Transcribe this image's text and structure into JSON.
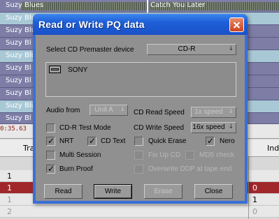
{
  "background": {
    "clip_name_main": "Suzy Blues",
    "clip_name_truncated": "Suzy Bl",
    "clip_name_truncated2": "Suzy Blu",
    "clip_name_second": "Catch You Later",
    "time_readout": "0:35.63",
    "column_tra": "Tra",
    "column_ind": "Ind",
    "rows": [
      {
        "c1": "1",
        "c2": ""
      },
      {
        "c1": "1",
        "c2": "0"
      },
      {
        "c1": "1",
        "c2": "1"
      },
      {
        "c1": "2",
        "c2": "0"
      }
    ]
  },
  "dialog": {
    "title": "Read or Write PQ data",
    "select_device_label": "Select CD Premaster device",
    "device_type_value": "CD-R",
    "device_list": [
      "SONY"
    ],
    "audio_from_label": "Audio from",
    "audio_from_value": "Unit A",
    "read_speed_label": "CD Read Speed",
    "read_speed_value": "1x speed",
    "write_speed_label": "CD Write Speed",
    "write_speed_value": "16x speed",
    "options": {
      "test_mode": {
        "label": "CD-R Test Mode",
        "checked": false
      },
      "nrt": {
        "label": "NRT",
        "checked": true
      },
      "cd_text": {
        "label": "CD Text",
        "checked": true
      },
      "multi_session": {
        "label": "Multi Session",
        "checked": false
      },
      "burn_proof": {
        "label": "Burn Proof",
        "checked": true
      },
      "quick_erase": {
        "label": "Quick Erase",
        "checked": false
      },
      "nero": {
        "label": "Nero",
        "checked": true
      },
      "fix_up_cd": {
        "label": "Fix Up CD",
        "checked": false
      },
      "md5_check": {
        "label": "MD5 check",
        "checked": false
      },
      "overwrite_ddp": {
        "label": "Overwrite DDP at tape end",
        "checked": false
      }
    },
    "buttons": {
      "read": "Read",
      "write": "Write",
      "erase": "Erase",
      "close": "Close"
    },
    "arrow_glyph": "↓"
  },
  "colors": {
    "title_bar": "#1e5ed6",
    "dialog_face": "#909090",
    "selected_row": "#a0282a"
  }
}
